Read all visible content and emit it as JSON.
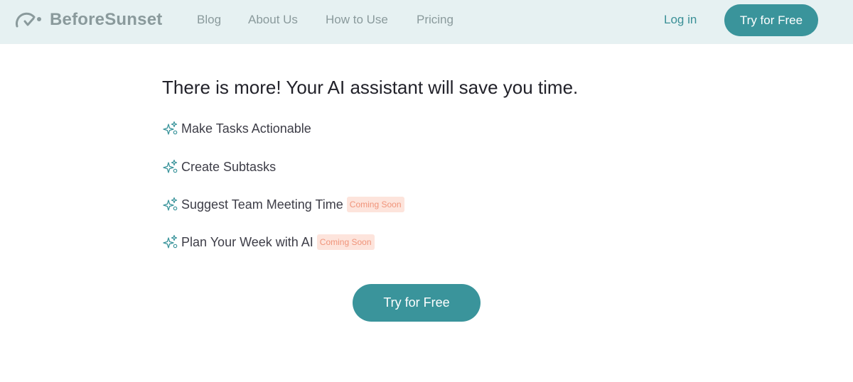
{
  "brand": {
    "name": "BeforeSunset",
    "color": "#8a9a9c",
    "icon": "sunset-gauge-icon"
  },
  "nav": {
    "links": [
      "Blog",
      "About Us",
      "How to Use",
      "Pricing"
    ],
    "login": "Log in",
    "cta": "Try for Free"
  },
  "main": {
    "headline": "There is more! Your AI assistant will save you time.",
    "features": [
      {
        "label": "Make Tasks Actionable",
        "icon": "sparkle-icon"
      },
      {
        "label": "Create Subtasks",
        "icon": "sparkle-icon"
      },
      {
        "label": "Suggest Team Meeting Time",
        "icon": "sparkle-icon",
        "badge": "Coming Soon"
      },
      {
        "label": "Plan Your Week with AI",
        "icon": "sparkle-icon",
        "badge": "Coming Soon"
      }
    ],
    "cta": "Try for Free"
  },
  "colors": {
    "nav_bg": "#e6f1f2",
    "accent": "#3a949b",
    "badge_bg": "#fde4dc",
    "badge_text": "#f0947a"
  }
}
